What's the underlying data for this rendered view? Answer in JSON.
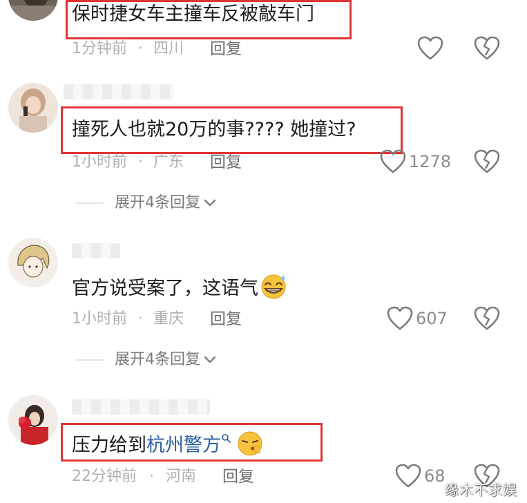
{
  "comments": [
    {
      "text": "保时捷女车主撞车反被敲车门",
      "time": "1分钟前",
      "dot": "·",
      "region": "四川",
      "reply_label": "回复",
      "like_count": ""
    },
    {
      "text": "撞死人也就20万的事???? 她撞过?",
      "time": "1小时前",
      "dot": "·",
      "region": "广东",
      "reply_label": "回复",
      "like_count": "1278",
      "expand_label": "展开4条回复"
    },
    {
      "text": "官方说受案了，这语气",
      "time": "1小时前",
      "dot": "·",
      "region": "重庆",
      "reply_label": "回复",
      "like_count": "607",
      "expand_label": "展开4条回复"
    },
    {
      "text_prefix": "压力给到",
      "mention": "杭州警方",
      "time": "22分钟前",
      "dot": "·",
      "region": "河南",
      "reply_label": "回复",
      "like_count": "68"
    }
  ],
  "watermark": "缘木不求娱",
  "colors": {
    "highlight": "#e03434",
    "mention": "#2c5fa3",
    "meta": "#b0b0b0"
  },
  "icons": [
    "heart-outline-icon",
    "broken-heart-icon",
    "chevron-down-icon",
    "search-icon",
    "grinning-sweat-emoji",
    "shushing-emoji"
  ]
}
